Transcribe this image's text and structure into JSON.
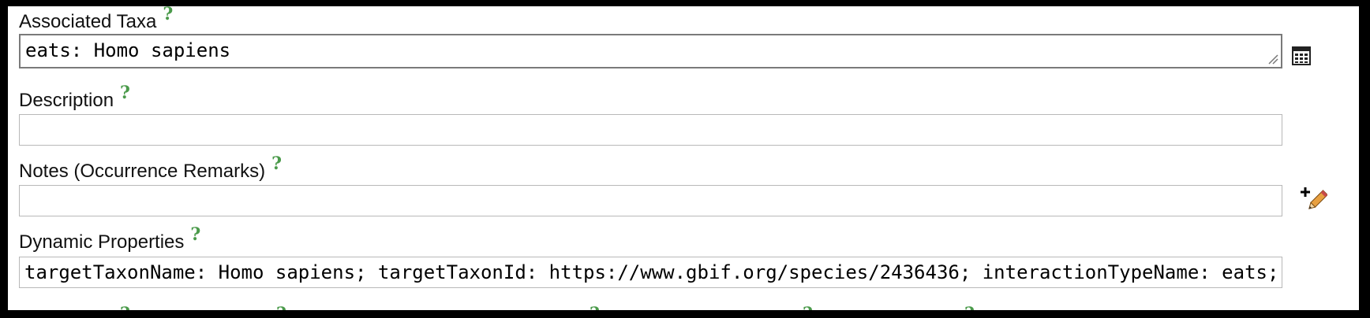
{
  "fields": {
    "associated_taxa": {
      "label": "Associated Taxa",
      "help": "?",
      "value": "eats: Homo sapiens"
    },
    "description": {
      "label": "Description",
      "help": "?",
      "value": ""
    },
    "notes": {
      "label": "Notes (Occurrence Remarks)",
      "help": "?",
      "value": ""
    },
    "dynamic_properties": {
      "label": "Dynamic Properties",
      "help": "?",
      "value": "targetTaxonName: Homo sapiens; targetTaxonId: https://www.gbif.org/species/2436436; interactionTypeName: eats;"
    }
  },
  "cutoff_help": [
    "?",
    "?",
    "?",
    "?",
    "?"
  ],
  "icons": {
    "taxa_picker": "table-grid-icon",
    "notes_editor": "add-edit-pencil-icon"
  }
}
